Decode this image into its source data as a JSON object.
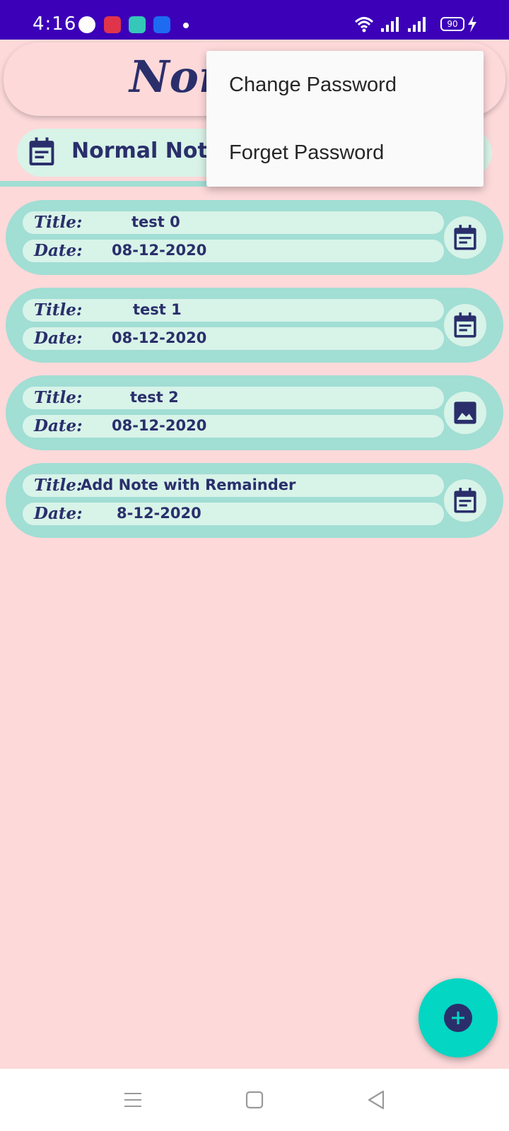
{
  "status_bar": {
    "time": "4:16",
    "battery": "90",
    "icons": [
      "message-icon",
      "screen-record-icon",
      "gallery-icon",
      "usb-icon",
      "notification-dot-icon",
      "wifi-icon",
      "signal-icon",
      "signal-icon",
      "battery-icon",
      "charging-icon"
    ]
  },
  "header": {
    "title": "Normal Notes"
  },
  "tab": {
    "label": "Normal Notes",
    "icon": "calendar-note-icon"
  },
  "notes": [
    {
      "title_label": "Title:",
      "title": "test 0",
      "date_label": "Date:",
      "date": "08-12-2020",
      "icon": "calendar-note-icon"
    },
    {
      "title_label": "Title:",
      "title": "test 1",
      "date_label": "Date:",
      "date": "08-12-2020",
      "icon": "calendar-note-icon"
    },
    {
      "title_label": "Title:",
      "title": "test 2",
      "date_label": "Date:",
      "date": "08-12-2020",
      "icon": "image-icon"
    },
    {
      "title_label": "Title:",
      "title": "Add Note with Remainder",
      "date_label": "Date:",
      "date": "8-12-2020",
      "icon": "calendar-note-icon"
    }
  ],
  "menu": {
    "items": [
      "Change Password",
      "Forget Password"
    ]
  },
  "fab": {
    "icon": "add-icon"
  },
  "nav_bar": {
    "icons": [
      "menu-icon",
      "home-icon",
      "back-icon"
    ]
  },
  "colors": {
    "background": "#fdd9da",
    "status_bar": "#3b00b8",
    "card": "#a1ded4",
    "pill": "#d8f3e8",
    "text_dark": "#2a2f6b",
    "fab": "#03d6c3"
  }
}
